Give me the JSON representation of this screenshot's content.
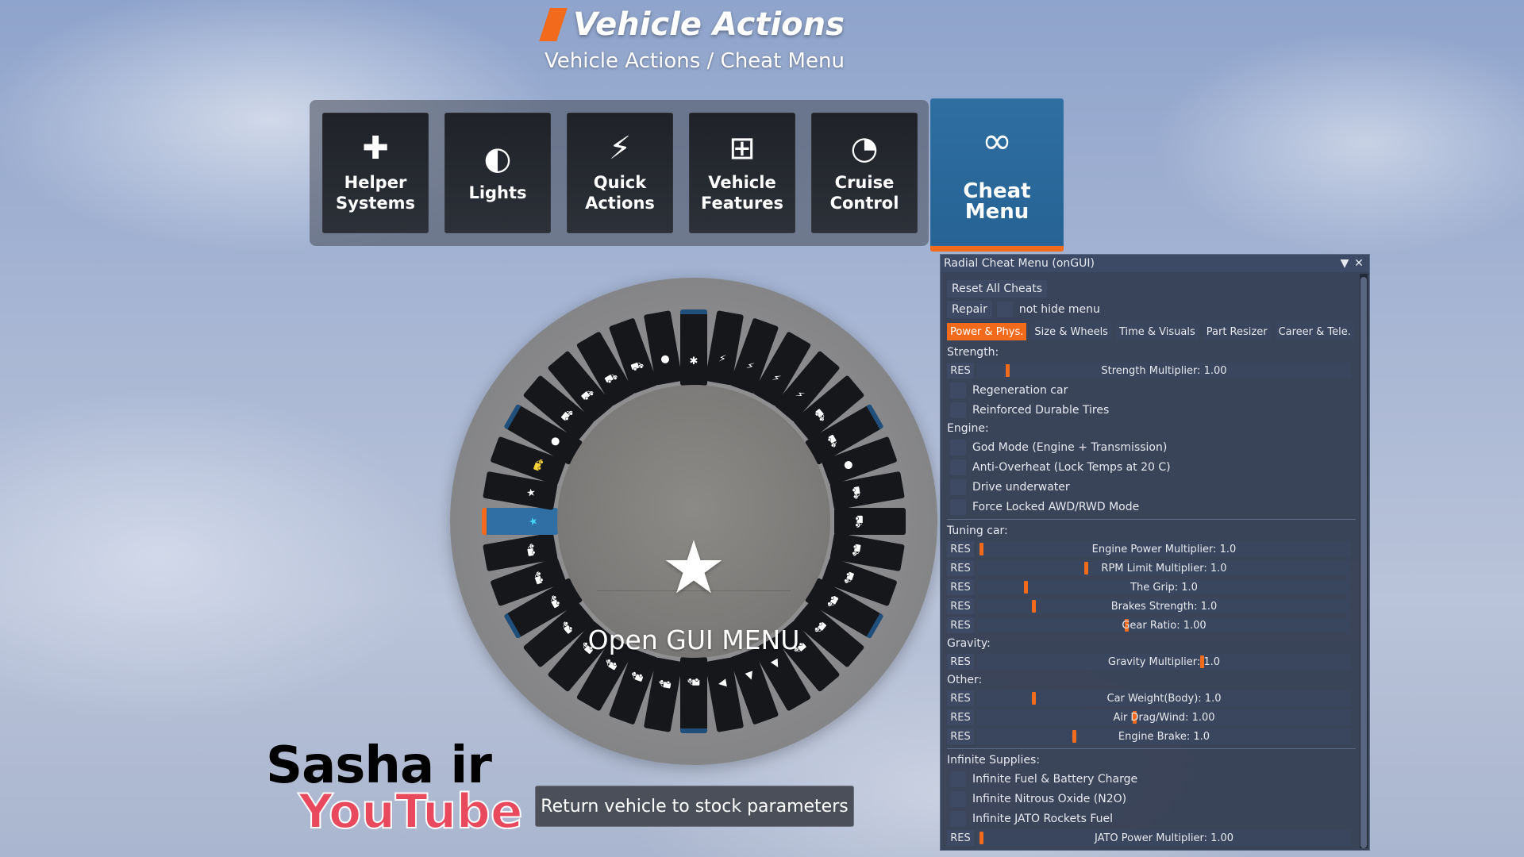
{
  "header": {
    "title": "Vehicle Actions",
    "subtitle": "Vehicle Actions / Cheat Menu"
  },
  "tabs": [
    {
      "label": "Helper\nSystems",
      "icon": "helper-shield-hand-icon"
    },
    {
      "label": "Lights",
      "icon": "headlight-icon"
    },
    {
      "label": "Quick\nActions",
      "icon": "lightning-icon"
    },
    {
      "label": "Vehicle\nFeatures",
      "icon": "touch-plus-icon"
    },
    {
      "label": "Cruise\nControl",
      "icon": "speedometer-icon"
    },
    {
      "label": "Cheat Menu",
      "icon": "infinity-icon",
      "active": true
    }
  ],
  "radial": {
    "center_label": "Open GUI MENU",
    "center_icon": "star-icon",
    "segment_count": 36
  },
  "return_button": "Return vehicle to stock parameters",
  "watermark": {
    "line1": "Sasha ir",
    "line2": "YouTube"
  },
  "panel": {
    "title": "Radial Cheat Menu (onGUI)",
    "reset_all": "Reset All Cheats",
    "repair": "Repair",
    "not_hide": "not hide menu",
    "tabs": [
      "Power & Phys.",
      "Size & Wheels",
      "Time & Visuals",
      "Part Resizer",
      "Career & Tele."
    ],
    "active_tab": 0,
    "res_label": "RES",
    "strength": {
      "heading": "Strength:",
      "slider": {
        "label": "Strength Multiplier: 1.00",
        "value": 0.08
      },
      "checks": [
        "Regeneration car",
        "Reinforced Durable Tires"
      ]
    },
    "engine": {
      "heading": "Engine:",
      "checks": [
        "God Mode (Engine + Transmission)",
        "Anti-Overheat (Lock Temps at 20 C)",
        "Drive underwater",
        "Force Locked AWD/RWD Mode"
      ]
    },
    "tuning": {
      "heading": "Tuning car:",
      "sliders": [
        {
          "label": "Engine Power Multiplier: 1.0",
          "value": 0.01
        },
        {
          "label": "RPM Limit Multiplier: 1.0",
          "value": 0.29
        },
        {
          "label": "The Grip: 1.0",
          "value": 0.13
        },
        {
          "label": "Brakes Strength: 1.0",
          "value": 0.15
        },
        {
          "label": "Gear Ratio: 1.00",
          "value": 0.4
        }
      ]
    },
    "gravity": {
      "heading": "Gravity:",
      "slider": {
        "label": "Gravity Multiplier: 1.0",
        "value": 0.6
      }
    },
    "other": {
      "heading": "Other:",
      "sliders": [
        {
          "label": "Car Weight(Body): 1.0",
          "value": 0.15
        },
        {
          "label": "Air Drag/Wind: 1.00",
          "value": 0.42
        },
        {
          "label": "Engine Brake: 1.0",
          "value": 0.26
        }
      ]
    },
    "supplies": {
      "heading": "Infinite Supplies:",
      "checks": [
        "Infinite Fuel & Battery Charge",
        "Infinite Nitrous Oxide (N2O)",
        "Infinite JATO Rockets Fuel"
      ],
      "slider": {
        "label": "JATO Power Multiplier: 1.00",
        "value": 0.01
      }
    }
  }
}
